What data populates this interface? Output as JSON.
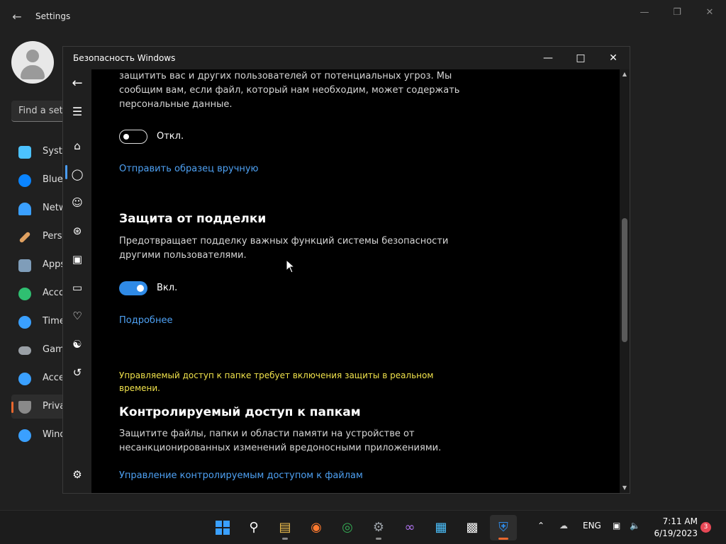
{
  "settings": {
    "title": "Settings",
    "search_placeholder": "Find a set",
    "nav": [
      {
        "label": "Syste",
        "icon": "system-icon",
        "color": "#4cc2ff"
      },
      {
        "label": "Blue",
        "icon": "bluetooth-icon",
        "color": "#0a84ff"
      },
      {
        "label": "Netw",
        "icon": "network-icon",
        "color": "#3aa0ff"
      },
      {
        "label": "Perso",
        "icon": "personalization-icon",
        "color": "#e0a060"
      },
      {
        "label": "Apps",
        "icon": "apps-icon",
        "color": "#7f9db9"
      },
      {
        "label": "Acco",
        "icon": "accounts-icon",
        "color": "#2fbf71"
      },
      {
        "label": "Time",
        "icon": "time-language-icon",
        "color": "#3aa0ff"
      },
      {
        "label": "Gam",
        "icon": "gaming-icon",
        "color": "#9aa0a6"
      },
      {
        "label": "Acce",
        "icon": "accessibility-icon",
        "color": "#3aa0ff"
      },
      {
        "label": "Priva",
        "icon": "privacy-icon",
        "color": "#8a8a8a"
      },
      {
        "label": "Wind",
        "icon": "windows-update-icon",
        "color": "#3aa0ff"
      }
    ]
  },
  "security": {
    "title": "Безопасность Windows",
    "intro_text": "защитить вас и других пользователей от потенциальных угроз. Мы сообщим вам, если файл, который нам необходим, может содержать персональные данные.",
    "sample_toggle": {
      "label": "Откл.",
      "state": "off"
    },
    "sample_link": "Отправить образец вручную",
    "tamper": {
      "heading": "Защита от подделки",
      "description": "Предотвращает подделку важных функций системы безопасности другими пользователями.",
      "toggle": {
        "label": "Вкл.",
        "state": "on"
      },
      "link": "Подробнее"
    },
    "warning": "Управляемый доступ к папке требует включения защиты в реальном времени.",
    "cfa": {
      "heading": "Контролируемый доступ к папкам",
      "description": "Защитите файлы, папки и области памяти на устройстве от несанкционированных изменений вредоносными приложениями.",
      "link": "Управление контролируемым доступом к файлам"
    }
  },
  "taskbar": {
    "language": "ENG",
    "time": "7:11 AM",
    "date": "6/19/2023",
    "notifications": "3"
  },
  "colors": {
    "accent": "#2f8ae6",
    "link": "#4ea1f3",
    "warning": "#f0e24b"
  }
}
